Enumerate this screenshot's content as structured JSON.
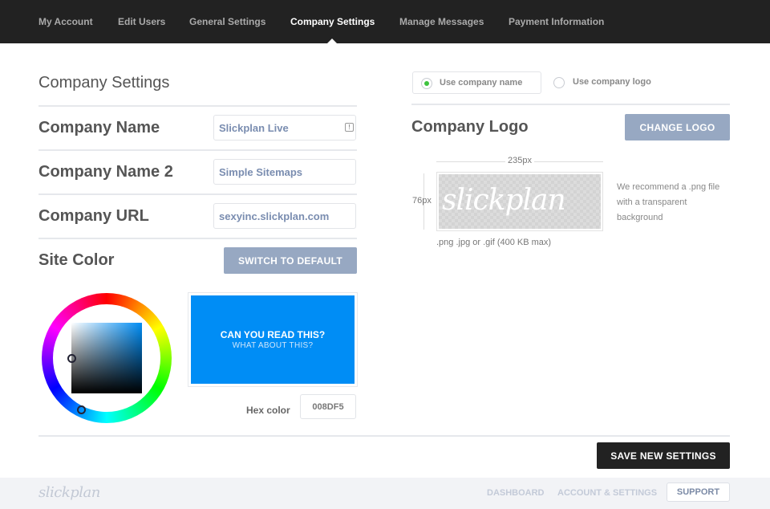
{
  "nav": {
    "items": [
      {
        "label": "My Account"
      },
      {
        "label": "Edit Users"
      },
      {
        "label": "General Settings"
      },
      {
        "label": "Company Settings",
        "active": true
      },
      {
        "label": "Manage Messages"
      },
      {
        "label": "Payment Information"
      }
    ]
  },
  "company": {
    "section_title": "Company Settings",
    "name_label": "Company Name",
    "name_value": "Slickplan Live",
    "name2_label": "Company Name 2",
    "name2_value": "Simple Sitemaps",
    "url_label": "Company URL",
    "url_value": "sexyinc.slickplan.com",
    "site_color_label": "Site Color",
    "switch_default_label": "SWITCH TO DEFAULT"
  },
  "color_picker": {
    "preview_title": "CAN YOU READ THIS?",
    "preview_subtitle": "WHAT ABOUT THIS?",
    "hex_label": "Hex color",
    "hex_value": "008DF5",
    "selected_color": "#008df5"
  },
  "logo": {
    "use_name_label": "Use company name",
    "use_logo_label": "Use company logo",
    "selected_option": "name",
    "title": "Company Logo",
    "change_label": "CHANGE LOGO",
    "width_label": "235px",
    "height_label": "76px",
    "placeholder_text": "slickplan",
    "recommend_note": "We recommend a .png file with a transparent background",
    "formats_note": ".png .jpg or .gif (400 KB max)"
  },
  "actions": {
    "save_label": "SAVE NEW SETTINGS"
  },
  "footer": {
    "logo_text": "slickplan",
    "dashboard_label": "DASHBOARD",
    "account_label": "ACCOUNT & SETTINGS",
    "support_label": "SUPPORT"
  },
  "colors": {
    "nav_bg": "#222222",
    "button_blue": "#97a8c2",
    "radio_on": "#3fc33f",
    "accent_blue": "#008df5"
  }
}
